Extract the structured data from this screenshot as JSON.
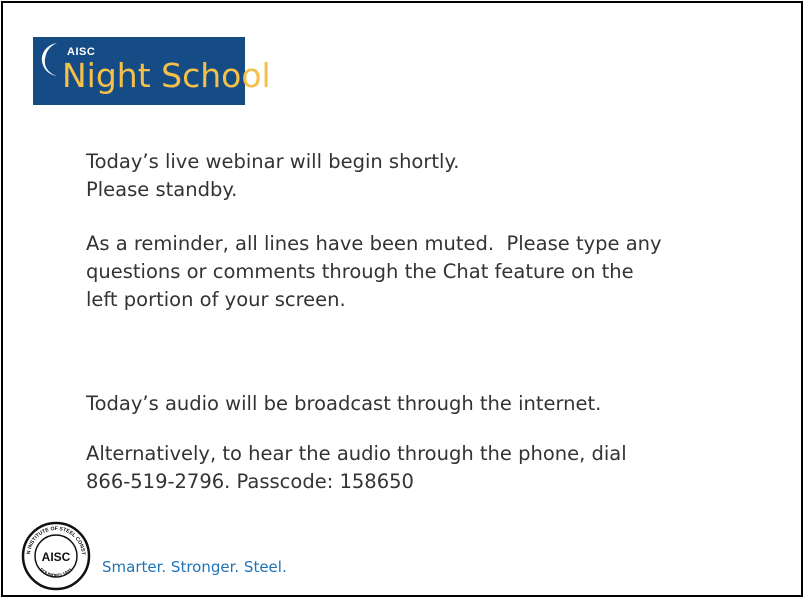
{
  "logo": {
    "org": "AISC",
    "title": "Night School",
    "colors": {
      "background": "#154c86",
      "title": "#f4c04a",
      "org": "#ffffff"
    }
  },
  "body": {
    "p1_line1": "Today’s live webinar will begin shortly.",
    "p1_line2": "Please standby.",
    "p2_line1": "As a reminder, all lines have been muted.  Please type any",
    "p2_line2": "questions or comments through the Chat feature on the",
    "p2_line3": "left portion of your screen.",
    "p3": "Today’s audio will be broadcast through the internet.",
    "p4_line1": "Alternatively, to hear the audio through the phone, dial",
    "p4_line2": "866-519-2796. Passcode: 158650"
  },
  "footer": {
    "seal_icon": "aisc-seal-icon",
    "seal_text_top": "AMERICAN INSTITUTE OF STEEL CONSTRUCTION",
    "seal_text_bottom": "FOUNDED 1921",
    "seal_center": "AISC",
    "tagline": "Smarter. Stronger. Steel.",
    "tagline_color": "#1f73b7"
  }
}
